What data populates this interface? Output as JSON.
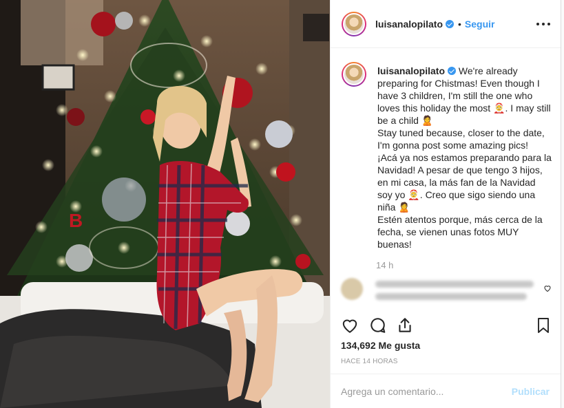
{
  "post": {
    "username": "luisanalopilato",
    "dot": "•",
    "follow_label": "Seguir",
    "more_icon": "more-horizontal-icon"
  },
  "caption": {
    "username": "luisanalopilato",
    "text": "We're already preparing for Chistmas! Even though I have 3 children, I'm still the one who loves this holiday the most 🤶. I may still be a child 🙎\nStay tuned because, closer to the date, I'm gonna post some amazing pics!\n¡Acá ya nos estamos preparando para la Navidad! A pesar de que tengo 3 hijos, en mi casa, la más fan de la Navidad soy yo 🤶. Creo que sigo siendo una niña 🙎\nEstén atentos porque, más cerca de la fecha, se vienen unas fotos MUY buenas!",
    "time": "14 h"
  },
  "engagement": {
    "likes": "134,692 Me gusta",
    "timestamp": "HACE 14 HORAS"
  },
  "comment": {
    "placeholder": "Agrega un comentario...",
    "publish_label": "Publicar"
  },
  "colors": {
    "accent": "#3897f0",
    "publish_disabled": "#b2dffc",
    "muted": "#999999"
  },
  "icons": [
    "heart-icon",
    "comment-icon",
    "share-icon",
    "bookmark-icon",
    "verified-badge-icon"
  ]
}
